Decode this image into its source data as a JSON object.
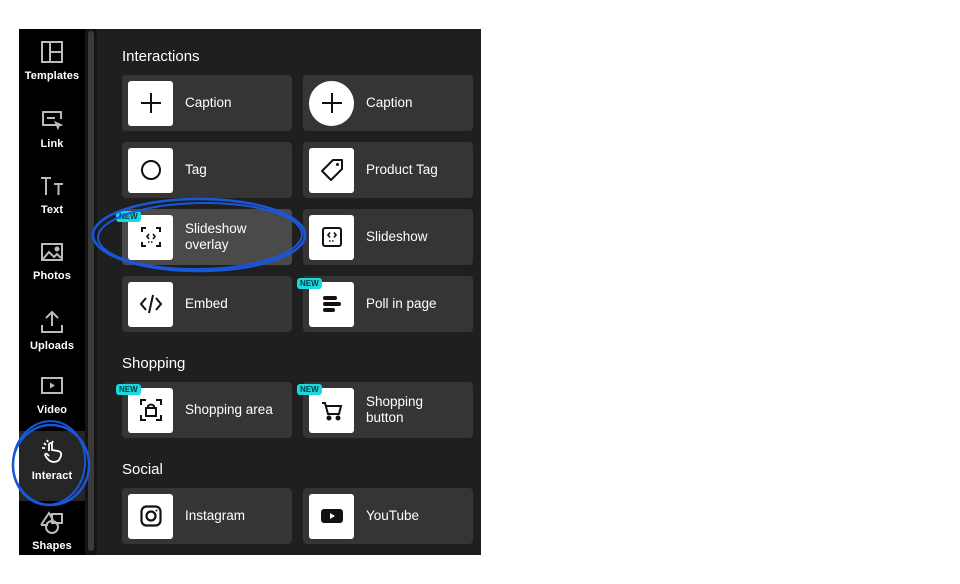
{
  "sidebar": {
    "items": [
      {
        "label": "Templates",
        "icon": "templates-icon"
      },
      {
        "label": "Link",
        "icon": "link-icon"
      },
      {
        "label": "Text",
        "icon": "text-icon"
      },
      {
        "label": "Photos",
        "icon": "photos-icon"
      },
      {
        "label": "Uploads",
        "icon": "uploads-icon"
      },
      {
        "label": "Video",
        "icon": "video-icon"
      },
      {
        "label": "Interact",
        "icon": "interact-icon",
        "active": true
      },
      {
        "label": "Shapes",
        "icon": "shapes-icon"
      }
    ]
  },
  "sections": {
    "interactions": {
      "title": "Interactions",
      "items": [
        {
          "label": "Caption",
          "icon": "plus-icon"
        },
        {
          "label": "Caption",
          "icon": "plus-circle-icon"
        },
        {
          "label": "Tag",
          "icon": "circle-icon"
        },
        {
          "label": "Product Tag",
          "icon": "tag-icon"
        },
        {
          "label": "Slideshow\noverlay",
          "icon": "slideshow-overlay-icon",
          "badge": "NEW"
        },
        {
          "label": "Slideshow",
          "icon": "slideshow-icon"
        },
        {
          "label": "Embed",
          "icon": "code-icon"
        },
        {
          "label": "Poll in page",
          "icon": "poll-icon",
          "badge": "NEW"
        }
      ]
    },
    "shopping": {
      "title": "Shopping",
      "items": [
        {
          "label": "Shopping area",
          "icon": "shopping-bag-icon",
          "badge": "NEW"
        },
        {
          "label": "Shopping\nbutton",
          "icon": "cart-icon",
          "badge": "NEW"
        }
      ]
    },
    "social": {
      "title": "Social",
      "items": [
        {
          "label": "Instagram",
          "icon": "instagram-icon"
        },
        {
          "label": "YouTube",
          "icon": "youtube-icon"
        }
      ]
    }
  },
  "colors": {
    "badge": "#19d8e0",
    "annotation": "#1a56d8"
  }
}
